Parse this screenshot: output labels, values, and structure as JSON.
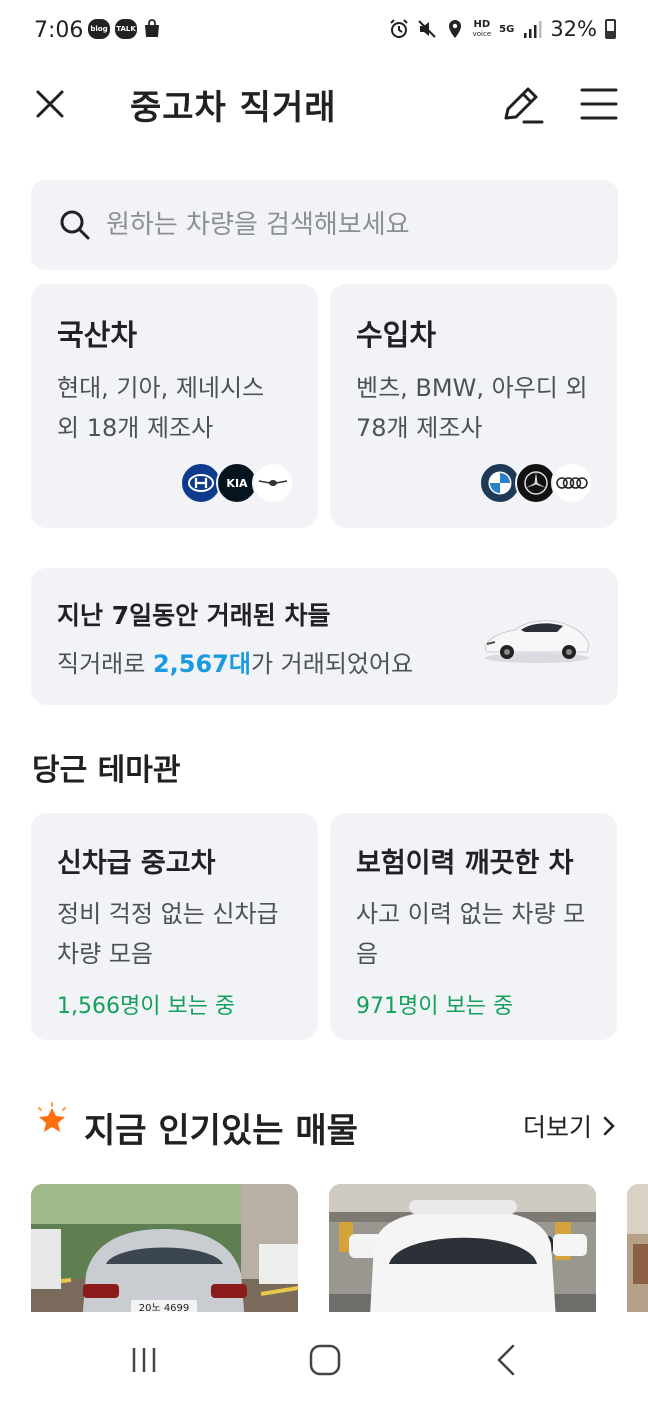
{
  "status_bar": {
    "time": "7:06",
    "left_icons": [
      "blog-icon",
      "talk-icon",
      "shopping-bag-icon"
    ],
    "blog": "blog",
    "talk": "TALK",
    "hd": "HD",
    "voice": "voice",
    "network": "5G",
    "battery": "32%",
    "right_icons": [
      "alarm-icon",
      "mute-icon",
      "location-icon",
      "hd-voice-icon",
      "5g-icon",
      "signal-icon",
      "battery-icon"
    ]
  },
  "header": {
    "title": "중고차 직거래",
    "close_icon": "close-icon",
    "edit_icon": "pencil-icon",
    "menu_icon": "hamburger-menu-icon"
  },
  "search": {
    "placeholder": "원하는 차량을 검색해보세요",
    "icon": "search-icon"
  },
  "categories": [
    {
      "title": "국산차",
      "desc_line1": "현대, 기아, 제네시스",
      "desc_line2": "외 18개 제조사",
      "logos": [
        "hyundai-logo",
        "kia-logo",
        "genesis-logo"
      ],
      "kia_text": "KIA"
    },
    {
      "title": "수입차",
      "desc_line1": "벤츠, BMW, 아우디 외",
      "desc_line2": "78개 제조사",
      "logos": [
        "bmw-logo",
        "mercedes-logo",
        "audi-logo"
      ]
    }
  ],
  "deals": {
    "title": "지난 7일동안 거래된 차들",
    "prefix": "직거래로 ",
    "count": "2,567대",
    "suffix": "가 거래되었어요",
    "image": "white-sedan-illustration",
    "accent_color": "#1a9be0"
  },
  "themes": {
    "section_title": "당근 테마관",
    "items": [
      {
        "title": "신차급 중고차",
        "desc_line1": "정비 걱정 없는 신차급",
        "desc_line2": "차량 모음",
        "viewers": "1,566명이 보는 중"
      },
      {
        "title": "보험이력 깨끗한 차",
        "desc_line1": "사고 이력 없는 차량 모",
        "desc_line2": "음",
        "viewers": "971명이 보는 중"
      }
    ],
    "viewers_color": "#12a05a"
  },
  "popular": {
    "title": "지금 인기있는 매물",
    "more": "더보기",
    "icon": "sparkle-star-icon",
    "listings": [
      {
        "image": "silver-sedan-rear-photo",
        "plate": "20노 4699"
      },
      {
        "image": "white-suv-front-photo"
      },
      {
        "image": "partial-listing-photo"
      }
    ]
  },
  "nav": {
    "icons": [
      "recent-apps-icon",
      "home-icon",
      "back-icon"
    ]
  }
}
